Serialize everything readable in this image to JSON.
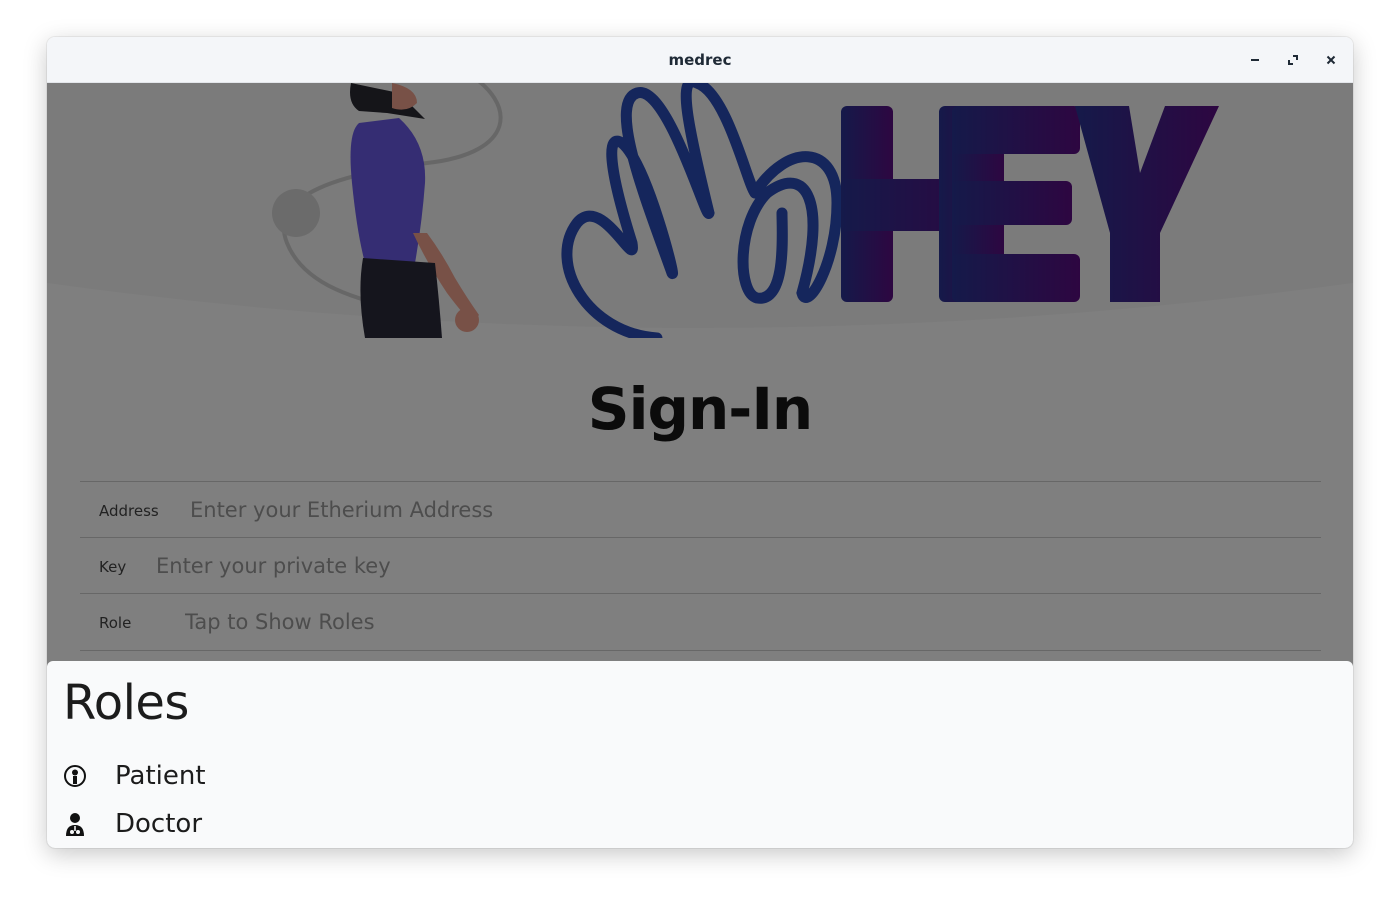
{
  "window": {
    "title": "medrec",
    "controls": {
      "minimize_icon": "minimize-icon",
      "maximize_icon": "maximize-icon",
      "close_icon": "close-icon"
    }
  },
  "hero": {
    "logo_text": "HEY",
    "colors": {
      "wave_blue": "#1f3c95",
      "hey_start": "#2a2f8f",
      "hey_end": "#5a0f7e",
      "shirt": "#6b5be6",
      "skin": "#f0a38f"
    }
  },
  "signin": {
    "heading": "Sign-In",
    "fields": [
      {
        "label": "Address",
        "placeholder": "Enter your Etherium Address"
      },
      {
        "label": "Key",
        "placeholder": "Enter your private key"
      },
      {
        "label": "Role",
        "placeholder": "Tap to Show Roles"
      }
    ]
  },
  "roles_sheet": {
    "title": "Roles",
    "items": [
      {
        "label": "Patient",
        "icon": "patient-icon"
      },
      {
        "label": "Doctor",
        "icon": "doctor-icon"
      }
    ]
  },
  "colors": {
    "scrim": "rgba(0,0,0,0.5)",
    "sheet_bg": "#f9fafb",
    "titlebar_bg": "#f4f6f9"
  }
}
